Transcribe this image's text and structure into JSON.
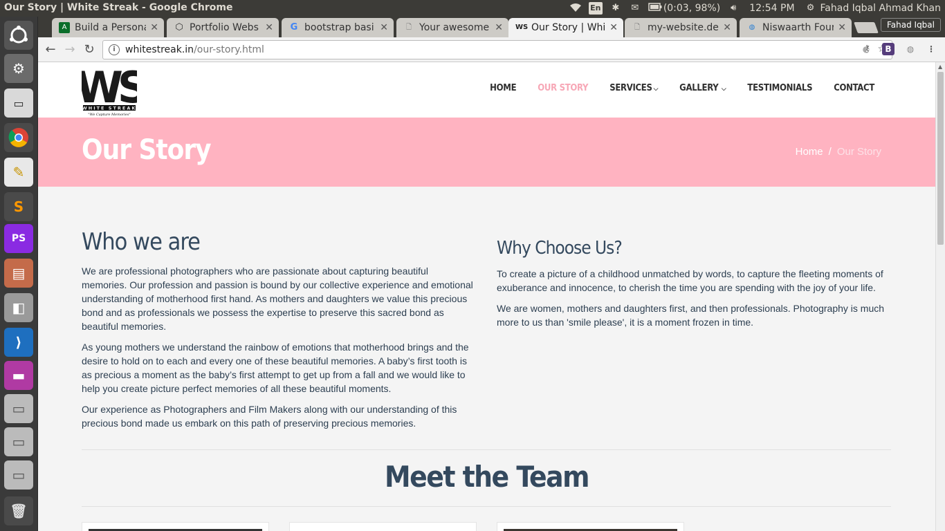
{
  "system": {
    "window_title": "Our Story | White Streak - Google Chrome",
    "keyboard": "En",
    "battery": "(0:03, 98%)",
    "clock": "12:54 PM",
    "user": "Fahad Iqbal Ahmad Khan"
  },
  "browser": {
    "profile": "Fahad Iqbal",
    "tabs": [
      {
        "label": "Build a Persona",
        "icon": "android-studio-icon",
        "color": "#0b6e2a",
        "active": false
      },
      {
        "label": "Portfolio Webs",
        "icon": "codepen-icon",
        "color": "#333333",
        "active": false
      },
      {
        "label": "bootstrap basi",
        "icon": "google-icon",
        "color": "#4285f4",
        "active": false
      },
      {
        "label": "Your awesome",
        "icon": "page-icon",
        "color": "#888888",
        "active": false
      },
      {
        "label": "Our Story | Whi",
        "icon": "white-streak-icon",
        "color": "#222222",
        "active": true
      },
      {
        "label": "my-website.dev",
        "icon": "page-icon",
        "color": "#888888",
        "active": false
      },
      {
        "label": "Niswaarth Four",
        "icon": "globe-icon",
        "color": "#2a7fd4",
        "active": false
      }
    ],
    "url_host": "whitestreak.in",
    "url_path": "/our-story.html"
  },
  "site": {
    "logo_text": "WS",
    "logo_sub": "WHITE STREAK",
    "logo_tagline": "\"We Capture Memories\"",
    "nav": [
      {
        "label": "HOME",
        "active": false,
        "dropdown": false
      },
      {
        "label": "OUR STORY",
        "active": true,
        "dropdown": false
      },
      {
        "label": "SERVICES",
        "active": false,
        "dropdown": true
      },
      {
        "label": "GALLERY",
        "active": false,
        "dropdown": true
      },
      {
        "label": "TESTIMONIALS",
        "active": false,
        "dropdown": false
      },
      {
        "label": "CONTACT",
        "active": false,
        "dropdown": false
      }
    ],
    "banner": {
      "title": "Our Story",
      "breadcrumb_home": "Home",
      "breadcrumb_sep": "/",
      "breadcrumb_current": "Our Story"
    },
    "who": {
      "heading": "Who we are",
      "p1": "We are professional photographers who are passionate about capturing beautiful memories. Our profession and passion is bound by our collective experience and emotional understanding of motherhood first hand. As mothers and daughters we value this precious bond and as professionals we possess the expertise to preserve this sacred bond as beautiful memories.",
      "p2": "As young mothers we understand the rainbow of emotions that motherhood brings and the desire to hold on to each and every one of these beautiful memories. A baby’s first tooth is as precious a moment as the baby’s first attempt to get up from a fall and we would like to help you create picture perfect memories of all these beautiful moments.",
      "p3": "Our experience as Photographers and Film Makers along with our understanding of this precious bond made us embark on this path of preserving precious memories."
    },
    "why": {
      "heading": "Why Choose Us?",
      "p1": "To create a picture of a childhood unmatched by words, to capture the fleeting moments of exuberance and innocence, to cherish the time you are spending with the joy of your life.",
      "p2": "We are women, mothers and daughters first, and then professionals. Photography is much more to us than 'smile please', it is a moment frozen in time."
    },
    "team_heading": "Meet the Team",
    "colors": {
      "accent_pink": "#ffb3c1",
      "active_nav": "#f7a7b6",
      "heading": "#34495e"
    }
  }
}
